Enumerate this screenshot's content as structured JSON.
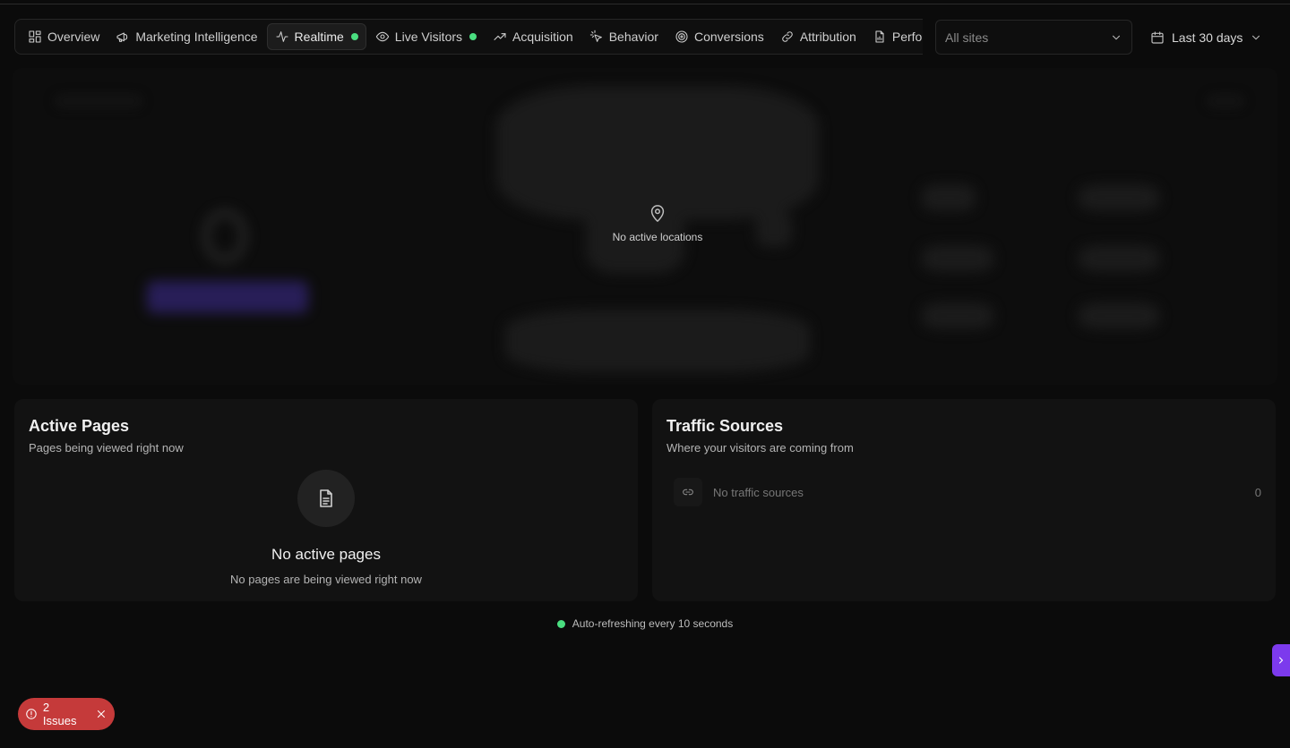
{
  "tabs": [
    {
      "label": "Overview",
      "icon": "dashboard-icon"
    },
    {
      "label": "Marketing Intelligence",
      "icon": "megaphone-icon"
    },
    {
      "label": "Realtime",
      "icon": "activity-icon",
      "active": true,
      "live": true
    },
    {
      "label": "Live Visitors",
      "icon": "eye-icon",
      "live": true
    },
    {
      "label": "Acquisition",
      "icon": "trending-up-icon"
    },
    {
      "label": "Behavior",
      "icon": "pointer-click-icon"
    },
    {
      "label": "Conversions",
      "icon": "target-icon"
    },
    {
      "label": "Attribution",
      "icon": "link-icon"
    },
    {
      "label": "Perform",
      "icon": "file-chart-icon"
    }
  ],
  "site_select": {
    "value": "All sites"
  },
  "date_range": {
    "label": "Last 30 days"
  },
  "map": {
    "empty_label": "No active locations"
  },
  "active_pages": {
    "title": "Active Pages",
    "subtitle": "Pages being viewed right now",
    "empty_title": "No active pages",
    "empty_subtitle": "No pages are being viewed right now"
  },
  "traffic_sources": {
    "title": "Traffic Sources",
    "subtitle": "Where your visitors are coming from",
    "empty_label": "No traffic sources",
    "count": "0"
  },
  "refresh_text": "Auto-refreshing every 10 seconds",
  "issues": {
    "label": "2 Issues"
  },
  "colors": {
    "accent": "#7c3aed",
    "live": "#4ade80",
    "danger": "#c53a3a"
  }
}
